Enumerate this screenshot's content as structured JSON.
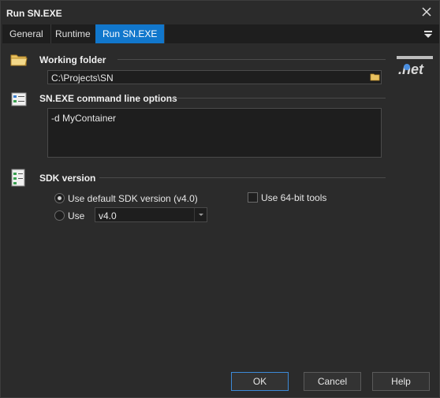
{
  "window": {
    "title": "Run SN.EXE"
  },
  "tabs": [
    {
      "label": "General"
    },
    {
      "label": "Runtime"
    },
    {
      "label": "Run SN.EXE"
    }
  ],
  "working_folder": {
    "title": "Working folder",
    "value": "C:\\Projects\\SN"
  },
  "command_options": {
    "title": "SN.EXE command line options",
    "value": "-d MyContainer"
  },
  "sdk": {
    "title": "SDK version",
    "default_option": "Use default SDK version (v4.0)",
    "use_option": "Use",
    "use_64bit": "Use 64-bit tools",
    "selected_version": "v4.0"
  },
  "buttons": {
    "ok": "OK",
    "cancel": "Cancel",
    "help": "Help"
  },
  "colors": {
    "accent": "#1177cc",
    "background": "#2b2b2b",
    "input_background": "#1e1e1e"
  }
}
